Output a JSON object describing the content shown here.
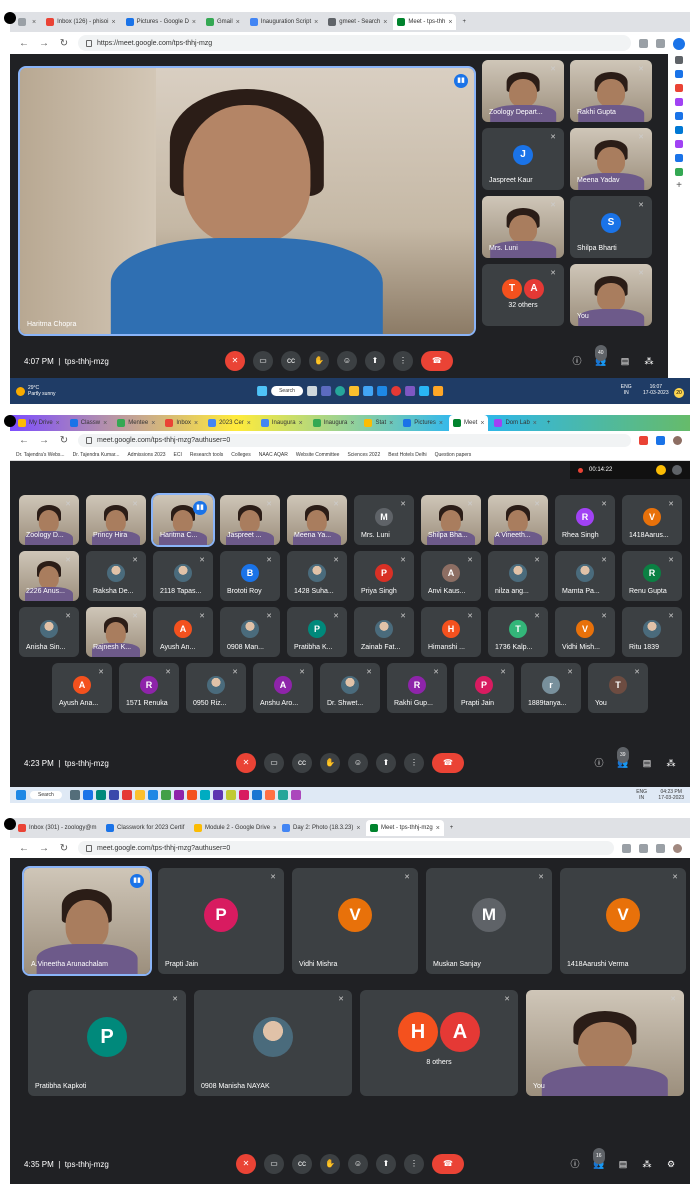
{
  "shot1": {
    "tabs": [
      {
        "label": "",
        "color": "#9aa0a6"
      },
      {
        "label": "Inbox (126) - phisoi",
        "color": "#ea4335"
      },
      {
        "label": "Pictures - Google D",
        "color": "#1a73e8"
      },
      {
        "label": "Gmail",
        "color": "#34a853"
      },
      {
        "label": "Inauguration Script",
        "color": "#4285f4"
      },
      {
        "label": "gmeet - Search",
        "color": "#5f6368"
      },
      {
        "label": "Meet - tps-thh",
        "color": "#00832d"
      }
    ],
    "url": "https://meet.google.com/tps-thhj-mzg",
    "main_speaker": "Haritma Chopra",
    "side_tiles": [
      {
        "name": "Zoology Depart...",
        "type": "video"
      },
      {
        "name": "Rakhi Gupta",
        "type": "video"
      },
      {
        "name": "Jaspreet Kaur",
        "type": "avatar",
        "letter": "J",
        "color": "#1a73e8"
      },
      {
        "name": "Meena Yadav",
        "type": "video"
      },
      {
        "name": "Mrs. Luni",
        "type": "video"
      },
      {
        "name": "Shilpa Bharti",
        "type": "avatar",
        "letter": "S",
        "color": "#1a73e8"
      },
      {
        "name": "32 others",
        "type": "others",
        "letters": [
          "T",
          "A"
        ]
      },
      {
        "name": "You",
        "type": "video"
      }
    ],
    "time": "4:07 PM",
    "meeting_code": "tps-thhj-mzg",
    "participants_count": "40",
    "weather_temp": "29°C",
    "weather_desc": "Partly sunny",
    "search_label": "Search",
    "lang": "ENG",
    "lang_region": "IN",
    "clock_time": "16:07",
    "clock_date": "17-03-2023",
    "notif_count": "20"
  },
  "shot2": {
    "tabs": [
      {
        "label": "My Drive",
        "color": "#fbbc04"
      },
      {
        "label": "Classw",
        "color": "#1a73e8"
      },
      {
        "label": "Mentee",
        "color": "#34a853"
      },
      {
        "label": "Inbox",
        "color": "#ea4335"
      },
      {
        "label": "2023 Cer",
        "color": "#4285f4"
      },
      {
        "label": "Inaugura",
        "color": "#4285f4"
      },
      {
        "label": "Inaugura",
        "color": "#34a853"
      },
      {
        "label": "Stat",
        "color": "#fbbc04"
      },
      {
        "label": "Pictures",
        "color": "#1a73e8"
      },
      {
        "label": "Meet",
        "color": "#00832d"
      },
      {
        "label": "Dom Lab",
        "color": "#a142f4"
      }
    ],
    "url": "meet.google.com/tps-thhj-mzg?authuser=0",
    "bookmarks": [
      "Dr. Tajendra's Webs...",
      "Dr. Tajendra Kumar...",
      "Admissions 2023",
      "ECI",
      "Research tools",
      "Colleges",
      "NAAC AQAR",
      "Website Committee",
      "Sciences 2022",
      "Best Hotels Delhi",
      "Question papers"
    ],
    "recording_time": "00:14:22",
    "rows": [
      [
        {
          "name": "Zoology D...",
          "type": "video"
        },
        {
          "name": "Princy Hira",
          "type": "video"
        },
        {
          "name": "Haritma C...",
          "type": "video",
          "speaking": true
        },
        {
          "name": "Jaspreet ...",
          "type": "video"
        },
        {
          "name": "Meena Ya...",
          "type": "video"
        },
        {
          "name": "Mrs. Luni",
          "type": "avatar",
          "letter": "M",
          "color": "#5f6368"
        },
        {
          "name": "Shilpa Bha...",
          "type": "video"
        },
        {
          "name": "A Vineeth...",
          "type": "video"
        },
        {
          "name": "Rhea Singh",
          "type": "avatar",
          "letter": "R",
          "color": "#a142f4"
        },
        {
          "name": "1418Aarus...",
          "type": "avatar",
          "letter": "V",
          "color": "#e8710a"
        }
      ],
      [
        {
          "name": "2226 Anus...",
          "type": "video"
        },
        {
          "name": "Raksha De...",
          "type": "photo"
        },
        {
          "name": "2118 Tapas...",
          "type": "photo"
        },
        {
          "name": "Brototi Roy",
          "type": "avatar",
          "letter": "B",
          "color": "#1a73e8"
        },
        {
          "name": "1428 Suha...",
          "type": "photo"
        },
        {
          "name": "Priya Singh",
          "type": "avatar",
          "letter": "P",
          "color": "#d93025"
        },
        {
          "name": "Anvi Kaus...",
          "type": "avatar",
          "letter": "A",
          "color": "#8d6e63"
        },
        {
          "name": "nilza ang...",
          "type": "photo"
        },
        {
          "name": "Mamta Pa...",
          "type": "photo"
        },
        {
          "name": "Renu Gupta",
          "type": "avatar",
          "letter": "R",
          "color": "#0b8043"
        }
      ],
      [
        {
          "name": "Anisha Sin...",
          "type": "photo"
        },
        {
          "name": "Rajnesh K...",
          "type": "video"
        },
        {
          "name": "Ayush An...",
          "type": "avatar",
          "letter": "A",
          "color": "#f4511e"
        },
        {
          "name": "0908 Man...",
          "type": "photo"
        },
        {
          "name": "Pratibha K...",
          "type": "avatar",
          "letter": "P",
          "color": "#00897b"
        },
        {
          "name": "Zainab Fat...",
          "type": "photo"
        },
        {
          "name": "Himanshi ...",
          "type": "avatar",
          "letter": "H",
          "color": "#f4511e"
        },
        {
          "name": "1736 Kalp...",
          "type": "avatar",
          "letter": "T",
          "color": "#33b679"
        },
        {
          "name": "Vidhi Mish...",
          "type": "avatar",
          "letter": "V",
          "color": "#e8710a"
        },
        {
          "name": "Ritu 1839",
          "type": "photo"
        }
      ],
      [
        {
          "name": "Ayush Ana...",
          "type": "avatar",
          "letter": "A",
          "color": "#f4511e"
        },
        {
          "name": "1571 Renuka",
          "type": "avatar",
          "letter": "R",
          "color": "#8e24aa"
        },
        {
          "name": "0950 Riz...",
          "type": "photo"
        },
        {
          "name": "Anshu Aro...",
          "type": "avatar",
          "letter": "A",
          "color": "#8e24aa"
        },
        {
          "name": "Dr. Shwet...",
          "type": "photo"
        },
        {
          "name": "Rakhi Gup...",
          "type": "avatar",
          "letter": "R",
          "color": "#8e24aa"
        },
        {
          "name": "Prapti Jain",
          "type": "avatar",
          "letter": "P",
          "color": "#d81b60"
        },
        {
          "name": "1889tanya...",
          "type": "avatar",
          "letter": "r",
          "color": "#78909c"
        },
        {
          "name": "You",
          "type": "avatar",
          "letter": "T",
          "color": "#6d4c41"
        }
      ]
    ],
    "time": "4:23 PM",
    "meeting_code": "tps-thhj-mzg",
    "participants_count": "39",
    "search_label": "Search",
    "lang": "ENG",
    "lang_region": "IN",
    "clock_time": "04:23 PM",
    "clock_date": "17-03-2023"
  },
  "shot3": {
    "tabs": [
      {
        "label": "Inbox (301) - zoology@m",
        "color": "#ea4335"
      },
      {
        "label": "Classwork for 2023 Certif",
        "color": "#1a73e8"
      },
      {
        "label": "Module 2 - Google Drive",
        "color": "#fbbc04"
      },
      {
        "label": "Day 2: Photo (18.3.23)",
        "color": "#4285f4"
      },
      {
        "label": "Meet - tps-thhj-mzg",
        "color": "#00832d"
      }
    ],
    "url": "meet.google.com/tps-thhj-mzg?authuser=0",
    "row1": [
      {
        "name": "A.Vineetha Arunachalam",
        "type": "video",
        "speaking": true
      },
      {
        "name": "Prapti Jain",
        "type": "avatar",
        "letter": "P",
        "color": "#d81b60"
      },
      {
        "name": "Vidhi Mishra",
        "type": "avatar",
        "letter": "V",
        "color": "#e8710a"
      },
      {
        "name": "Muskan Sanjay",
        "type": "avatar",
        "letter": "M",
        "color": "#5f6368"
      },
      {
        "name": "1418Aarushi Verma",
        "type": "avatar",
        "letter": "V",
        "color": "#e8710a"
      }
    ],
    "row2": [
      {
        "name": "Pratibha Kapkoti",
        "type": "avatar",
        "letter": "P",
        "color": "#00897b"
      },
      {
        "name": "0908 Manisha NAYAK",
        "type": "photo"
      },
      {
        "name": "8 others",
        "type": "others",
        "letters": [
          "H",
          "A"
        ]
      },
      {
        "name": "You",
        "type": "video"
      }
    ],
    "time": "4:35 PM",
    "meeting_code": "tps-thhj-mzg",
    "participants_count": "16"
  }
}
